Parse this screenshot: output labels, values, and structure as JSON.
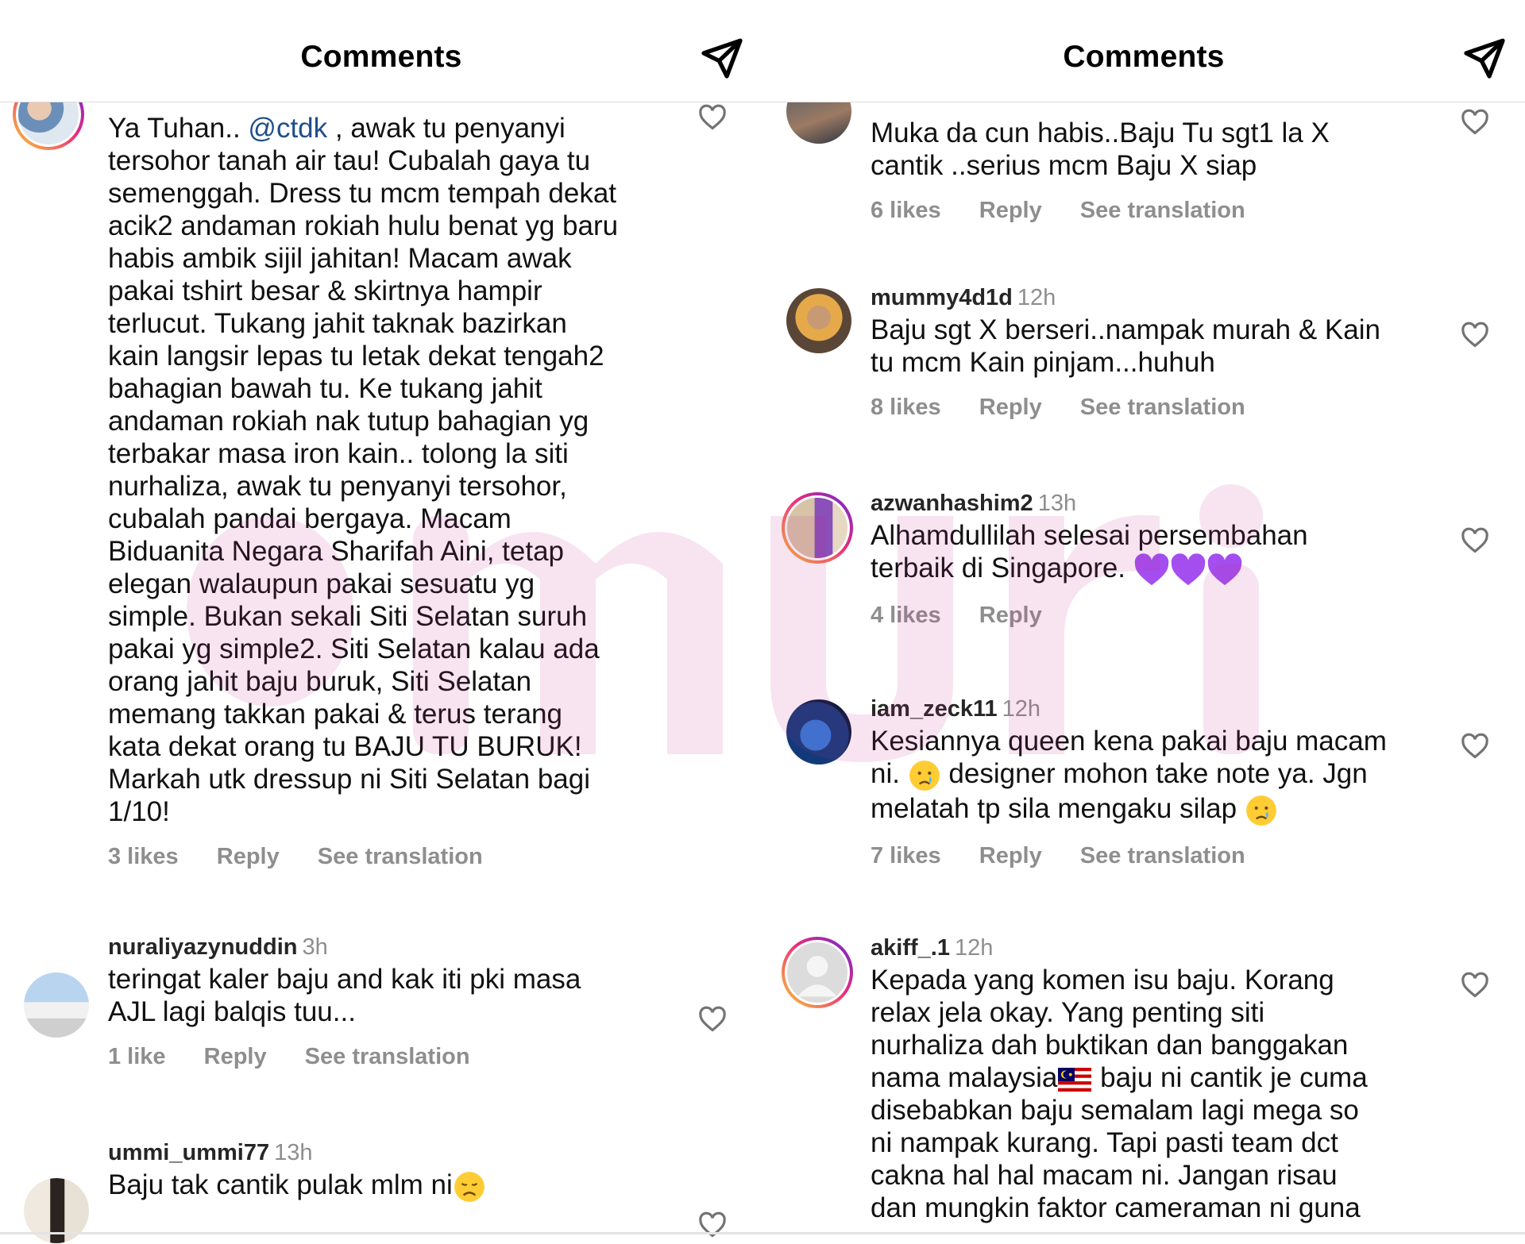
{
  "left": {
    "header_title": "Comments",
    "comments": [
      {
        "username": "",
        "time": "",
        "text_before_mention": "Ya Tuhan.. ",
        "mention": "@ctdk",
        "text_after_mention": " , awak tu penyanyi\ntersohor tanah air tau! Cubalah gaya tu\nsemenggah. Dress tu mcm tempah dekat\nacik2 andaman rokiah hulu benat yg baru\nhabis ambik sijil jahitan! Macam awak\npakai tshirt besar & skirtnya hampir\nterlucut. Tukang jahit taknak bazirkan\nkain langsir lepas tu letak dekat tengah2\nbahagian bawah tu. Ke tukang jahit\nandaman rokiah nak tutup bahagian yg\nterbakar masa iron kain.. tolong la siti\nnurhaliza, awak tu penyanyi tersohor,\ncubalah pandai bergaya. Macam\nBiduanita Negara Sharifah Aini, tetap\nelegan walaupun pakai sesuatu yg\nsimple. Bukan sekali Siti Selatan suruh\npakai yg simple2. Siti Selatan kalau ada\norang jahit baju buruk, Siti Selatan\nmemang takkan pakai & terus terang\nkata dekat orang tu BAJU TU BURUK!\nMarkah utk dressup ni Siti Selatan bagi\n1/10!",
        "likes": "3 likes",
        "reply": "Reply",
        "translate": "See translation"
      },
      {
        "username": "nuraliyazynuddin",
        "time": "3h",
        "text": "teringat kaler baju and kak iti pki masa\nAJL lagi balqis tuu...",
        "likes": "1 like",
        "reply": "Reply",
        "translate": "See translation"
      },
      {
        "username": "ummi_ummi77",
        "time": "13h",
        "text": "Baju tak cantik pulak mlm ni",
        "emoji": "disappointed-face"
      }
    ]
  },
  "right": {
    "header_title": "Comments",
    "comments": [
      {
        "text": "Muka da cun habis..Baju Tu sgt1 la X\ncantik ..serius mcm Baju X siap",
        "likes": "6 likes",
        "reply": "Reply",
        "translate": "See translation"
      },
      {
        "username": "mummy4d1d",
        "time": "12h",
        "text": "Baju sgt X berseri..nampak murah & Kain\ntu mcm Kain pinjam...huhuh",
        "likes": "8 likes",
        "reply": "Reply",
        "translate": "See translation"
      },
      {
        "username": "azwanhashim2",
        "time": "13h",
        "text": "Alhamdullilah selesai persembahan\nterbaik di Singapore.",
        "emoji": "purple-heart x3",
        "likes": "4 likes",
        "reply": "Reply"
      },
      {
        "username": "iam_zeck11",
        "time": "12h",
        "text_line1": "Kesiannya queen kena pakai baju macam",
        "text_line2_a": "ni.",
        "text_line2_b": " designer mohon take note ya. Jgn",
        "text_line3": "melatah tp sila mengaku silap",
        "emoji": "crying-face",
        "likes": "7 likes",
        "reply": "Reply",
        "translate": "See translation"
      },
      {
        "username": "akiff_.1",
        "time": "12h",
        "text_part1": "Kepada yang komen isu baju. Korang\nrelax jela okay. Yang penting siti\nnurhaliza dah buktikan dan banggakan\nnama malaysia",
        "text_part2": " baju ni cantik je cuma\ndisebabkan baju semalam lagi mega so\nni nampak kurang. Tapi pasti team dct\ncakna hal hal macam ni. Jangan risau\ndan mungkin faktor cameraman ni guna",
        "emoji": "malaysia-flag"
      }
    ]
  },
  "watermark": "murai",
  "colors": {
    "text": "#111111",
    "muted": "#8e8e8e",
    "mention": "#1f4e8c",
    "divider": "#dbdbdb",
    "purple_heart": "#a44ef0"
  }
}
